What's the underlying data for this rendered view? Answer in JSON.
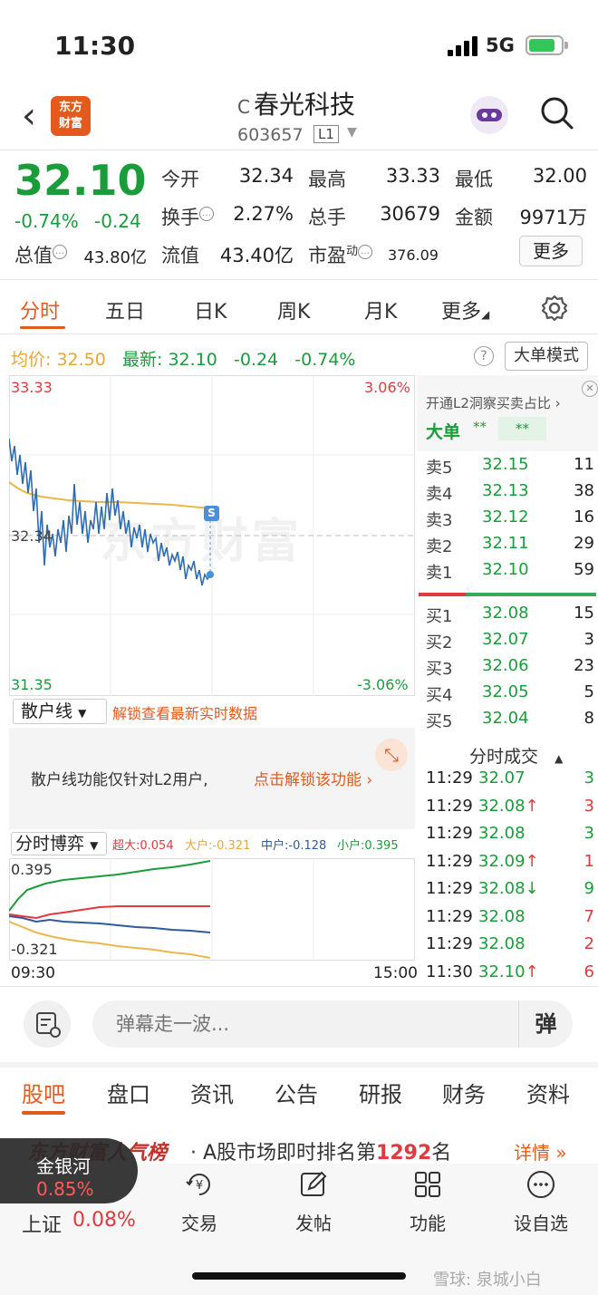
{
  "status_bar": {
    "time": "11:30",
    "network": "5G"
  },
  "header": {
    "logo_text_1": "东方",
    "logo_text_2": "财富",
    "stock_badge": "C",
    "stock_name": "春光科技",
    "stock_code": "603657",
    "level_badge": "L1"
  },
  "quote": {
    "price": "32.10",
    "change_pct": "-0.74%",
    "change_amt": "-0.24",
    "fields": {
      "open_label": "今开",
      "open": "32.34",
      "high_label": "最高",
      "high": "33.33",
      "low_label": "最低",
      "low": "32.00",
      "turnover_label": "换手",
      "turnover": "2.27%",
      "volume_label": "总手",
      "volume": "30679",
      "amount_label": "金额",
      "amount": "9971万",
      "mktcap_label": "总值",
      "mktcap": "43.80亿",
      "float_label": "流值",
      "float": "43.40亿",
      "pe_label": "市盈",
      "pe_sup": "动",
      "pe": "376.09"
    },
    "more_label": "更多"
  },
  "chart_tabs": [
    "分时",
    "五日",
    "日K",
    "周K",
    "月K",
    "更多"
  ],
  "avg_row": {
    "avg_label": "均价:",
    "avg_value": "32.50",
    "latest_label": "最新:",
    "latest_value": "32.10",
    "latest_change": "-0.24",
    "latest_pct": "-0.74%",
    "bigorder_btn": "大单模式"
  },
  "chart": {
    "y_top": "33.33",
    "y_mid": "32.34",
    "y_bottom": "31.35",
    "pct_top": "3.06%",
    "pct_bottom": "-3.06%",
    "watermark": "东方财富",
    "marker": "S",
    "colors": {
      "price": "#2f6db0",
      "avg": "#e8b84a"
    }
  },
  "orderbook": {
    "banner": "开通L2洞察买卖占比",
    "bigorder_label": "大单",
    "bigorder_stars_1": "**",
    "bigorder_stars_2": "**",
    "sells": [
      {
        "label": "卖5",
        "price": "32.15",
        "vol": "11"
      },
      {
        "label": "卖4",
        "price": "32.13",
        "vol": "38"
      },
      {
        "label": "卖3",
        "price": "32.12",
        "vol": "16"
      },
      {
        "label": "卖2",
        "price": "32.11",
        "vol": "29"
      },
      {
        "label": "卖1",
        "price": "32.10",
        "vol": "59"
      }
    ],
    "buys": [
      {
        "label": "买1",
        "price": "32.08",
        "vol": "15"
      },
      {
        "label": "买2",
        "price": "32.07",
        "vol": "3"
      },
      {
        "label": "买3",
        "price": "32.06",
        "vol": "23"
      },
      {
        "label": "买4",
        "price": "32.05",
        "vol": "5"
      },
      {
        "label": "买5",
        "price": "32.04",
        "vol": "8"
      }
    ]
  },
  "retail": {
    "select": "散户线",
    "unlock": "解锁查看最新实时数据",
    "notice": "散户线功能仅针对L2用户,",
    "notice_link": "点击解锁该功能"
  },
  "game": {
    "select": "分时博弈",
    "legend_super": "超大:0.054",
    "legend_large": "大户:-0.321",
    "legend_mid": "中户:-0.128",
    "legend_small": "小户:0.395",
    "y_top": "0.395",
    "y_bottom": "-0.321"
  },
  "trades": {
    "title": "分时成交",
    "rows": [
      {
        "time": "11:29",
        "price": "32.07",
        "arrow": "",
        "vol": "3",
        "color": "green",
        "vcolor": "green"
      },
      {
        "time": "11:29",
        "price": "32.08",
        "arrow": "↑",
        "vol": "3",
        "color": "green",
        "vcolor": "red"
      },
      {
        "time": "11:29",
        "price": "32.08",
        "arrow": "",
        "vol": "3",
        "color": "green",
        "vcolor": "green"
      },
      {
        "time": "11:29",
        "price": "32.09",
        "arrow": "↑",
        "vol": "1",
        "color": "green",
        "vcolor": "red"
      },
      {
        "time": "11:29",
        "price": "32.08",
        "arrow": "↓",
        "vol": "9",
        "color": "green",
        "vcolor": "green"
      },
      {
        "time": "11:29",
        "price": "32.08",
        "arrow": "",
        "vol": "7",
        "color": "green",
        "vcolor": "red"
      },
      {
        "time": "11:29",
        "price": "32.08",
        "arrow": "",
        "vol": "2",
        "color": "green",
        "vcolor": "red"
      },
      {
        "time": "11:30",
        "price": "32.10",
        "arrow": "↑",
        "vol": "6",
        "color": "green",
        "vcolor": "red"
      }
    ]
  },
  "time_axis": {
    "start": "09:30",
    "end": "15:00"
  },
  "danmaku": {
    "placeholder": "弹幕走一波...",
    "send": "弹"
  },
  "bottom_tabs": [
    "股吧",
    "盘口",
    "资讯",
    "公告",
    "研报",
    "财务",
    "资料"
  ],
  "ranking": {
    "title": "东方财富人气榜",
    "text_pre": "· A股市场即时排名第",
    "rank": "1292",
    "text_post": "名",
    "link": "详情 »"
  },
  "index_pill": {
    "name": "金银河",
    "pct": "0.85%"
  },
  "index_bar": {
    "label": "上证",
    "value": "0.08%"
  },
  "nav": [
    {
      "label": "交易",
      "icon": "yen-icon"
    },
    {
      "label": "发帖",
      "icon": "edit-icon"
    },
    {
      "label": "功能",
      "icon": "grid-icon"
    },
    {
      "label": "设自选",
      "icon": "more-icon"
    }
  ],
  "watermark": "雪球: 泉城小白"
}
